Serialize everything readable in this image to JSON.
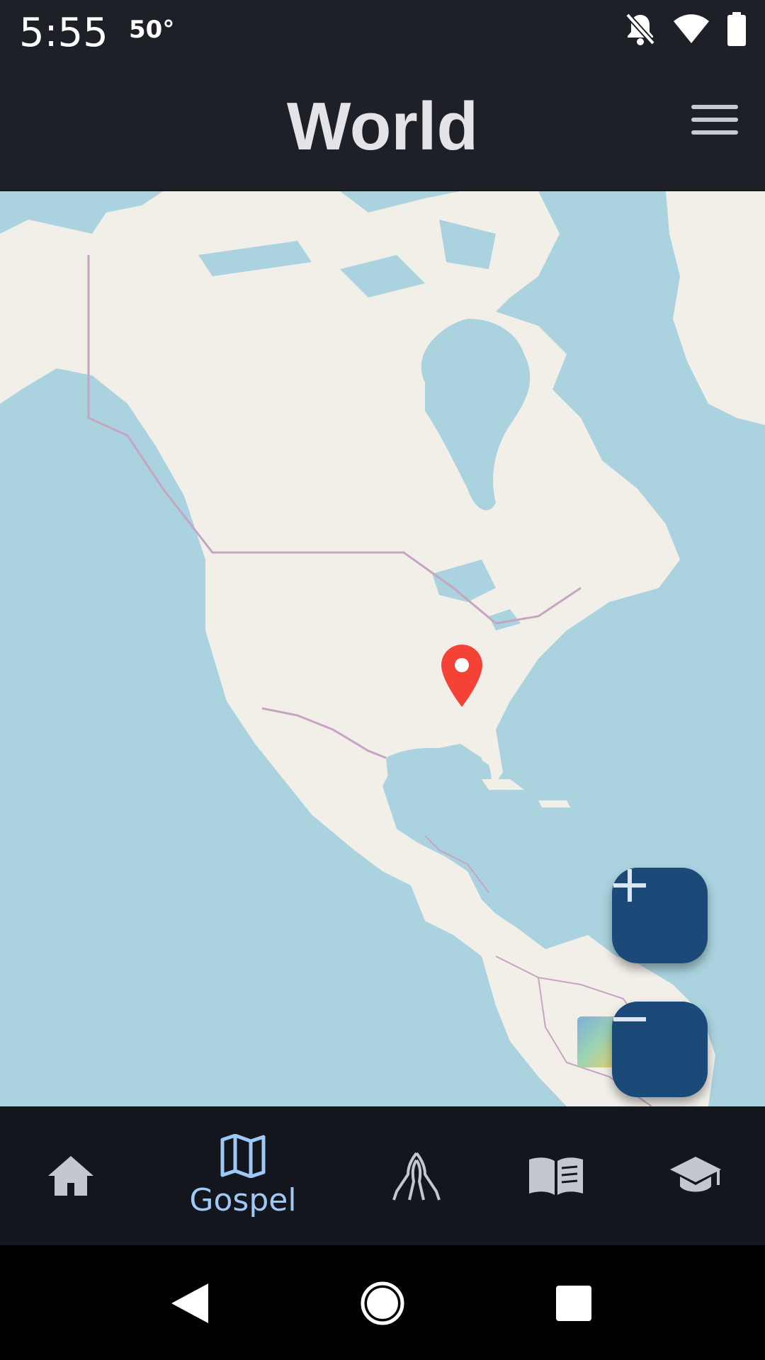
{
  "status_bar": {
    "time": "5:55",
    "temperature": "50°",
    "icons": [
      "notifications-off-icon",
      "wifi-icon",
      "battery-icon"
    ]
  },
  "app_bar": {
    "title": "World",
    "menu_icon": "hamburger-menu-icon"
  },
  "map": {
    "marker_icon": "location-pin-icon",
    "marker_color": "#f44336",
    "zoom_in_icon": "plus-icon",
    "zoom_out_icon": "minus-icon",
    "add_location_icon": "add-location-pin-icon",
    "button_color": "#1b4a78"
  },
  "bottom_nav": {
    "items": [
      {
        "icon": "home-icon",
        "label": "",
        "selected": false
      },
      {
        "icon": "map-icon",
        "label": "Gospel",
        "selected": true
      },
      {
        "icon": "praying-hands-icon",
        "label": "",
        "selected": false
      },
      {
        "icon": "open-book-icon",
        "label": "",
        "selected": false
      },
      {
        "icon": "graduation-cap-icon",
        "label": "",
        "selected": false
      }
    ],
    "selected_color": "#9ec8f6"
  },
  "system_nav": {
    "icons": [
      "back-icon",
      "home-circle-icon",
      "recents-icon"
    ]
  }
}
